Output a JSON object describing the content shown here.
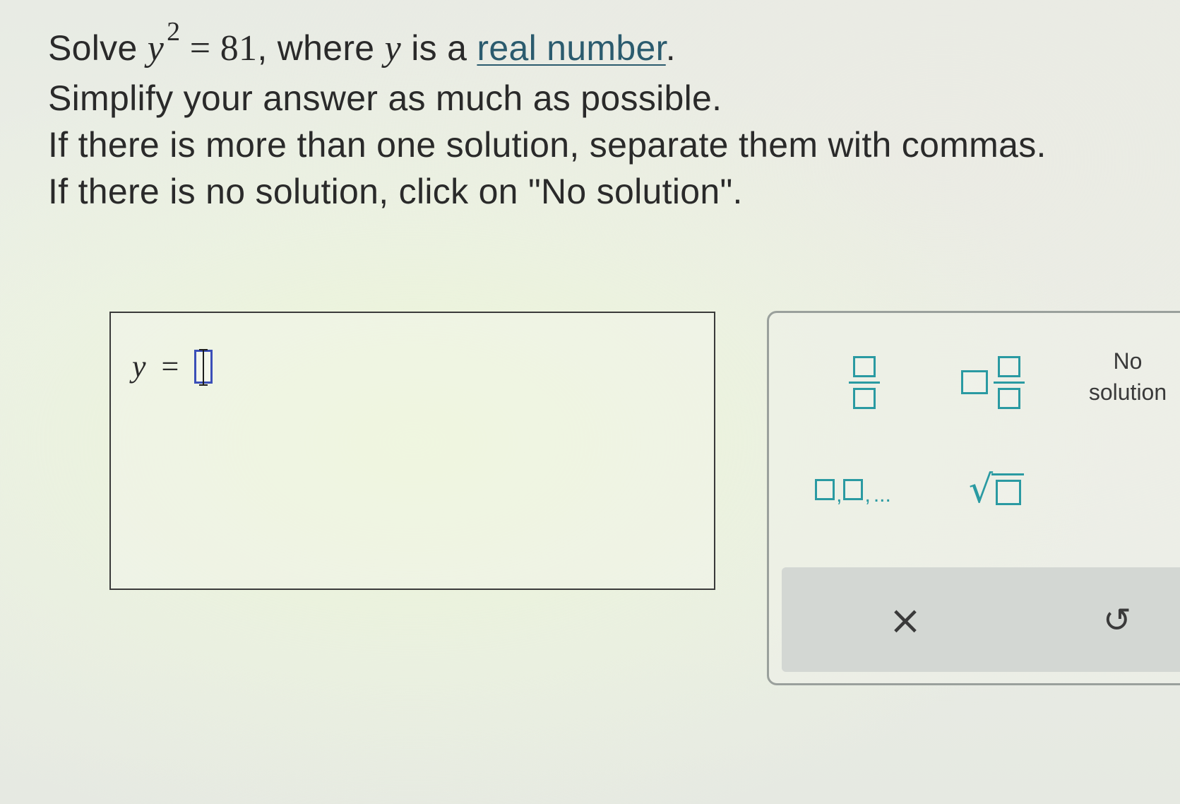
{
  "problem": {
    "solve_word": "Solve",
    "var": "y",
    "exponent": "2",
    "equals_value": "= 81",
    "where_text": ", where",
    "var2": "y",
    "is_a_text": "is a",
    "link_text": "real number",
    "period": ".",
    "line2": "Simplify your answer as much as possible.",
    "line3": "If there is more than one solution, separate them with commas.",
    "line4": "If there is no solution, click on \"No solution\"."
  },
  "answer": {
    "var": "y",
    "eq": "=",
    "value": ""
  },
  "keypad": {
    "no_solution_line1": "No",
    "no_solution_line2": "solution",
    "list_ellipsis": "...",
    "clear_icon": "×",
    "undo_icon": "↺"
  },
  "colors": {
    "accent": "#2a9aa2",
    "input_border": "#3b4fb8",
    "link": "#2b5b6e"
  }
}
